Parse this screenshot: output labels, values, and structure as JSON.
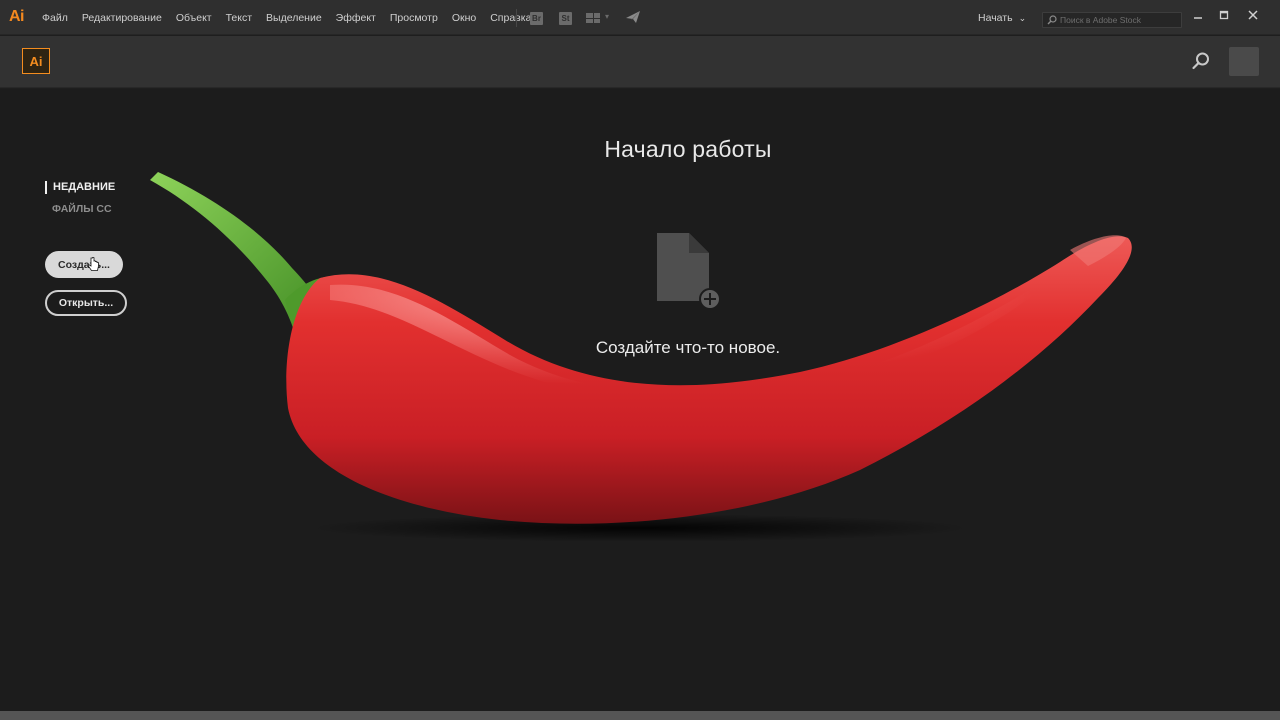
{
  "menubar": {
    "app_logo": "Ai",
    "menu_items": [
      "Файл",
      "Редактирование",
      "Объект",
      "Текст",
      "Выделение",
      "Эффект",
      "Просмотр",
      "Окно",
      "Справка"
    ],
    "tool_icons": [
      "Br",
      "St"
    ],
    "workspace_label": "Начать",
    "stock_search_placeholder": "Поиск в Adobe Stock"
  },
  "header": {
    "logo": "Ai"
  },
  "sidebar": {
    "recent_label": "НЕДАВНИЕ",
    "cc_files_label": "ФАЙЛЫ CC",
    "create_button": "Создать...",
    "open_button": "Открыть..."
  },
  "main": {
    "title": "Начало работы",
    "create_prompt": "Создайте что-то новое."
  },
  "colors": {
    "accent": "#f48d1f",
    "background": "#1c1c1c",
    "pepper_red": "#d8262b",
    "stem_green": "#6cb33b"
  },
  "icons": {
    "new_document": "new-document-plus-icon",
    "search": "search-icon",
    "rocket": "send-rocket-icon"
  }
}
